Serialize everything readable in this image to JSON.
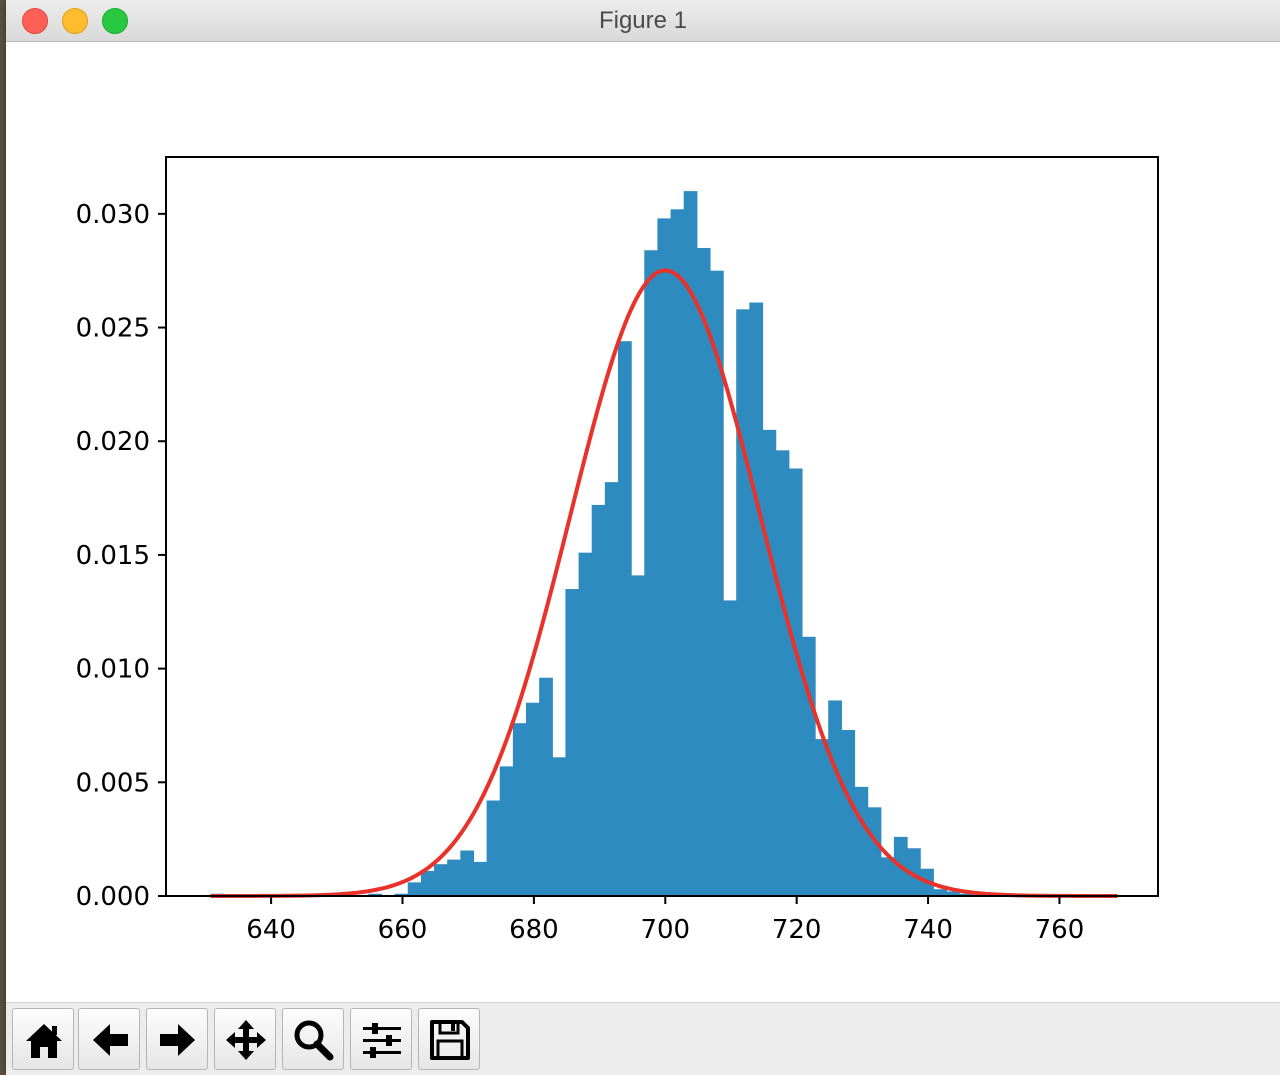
{
  "window": {
    "title": "Figure 1"
  },
  "toolbar": {
    "buttons": [
      {
        "name": "home-button",
        "icon": "home-icon"
      },
      {
        "name": "back-button",
        "icon": "arrow-left-icon"
      },
      {
        "name": "forward-button",
        "icon": "arrow-right-icon"
      },
      {
        "name": "pan-button",
        "icon": "move-icon"
      },
      {
        "name": "zoom-button",
        "icon": "zoom-icon"
      },
      {
        "name": "configure-subplots-button",
        "icon": "sliders-icon"
      },
      {
        "name": "save-button",
        "icon": "save-icon"
      }
    ]
  },
  "chart_data": {
    "type": "bar",
    "title": "",
    "xlabel": "",
    "ylabel": "",
    "xlim": [
      624,
      775
    ],
    "ylim": [
      0,
      0.0325
    ],
    "xticks": [
      "640",
      "660",
      "680",
      "700",
      "720",
      "740",
      "760"
    ],
    "xtick_values": [
      640,
      660,
      680,
      700,
      720,
      740,
      760
    ],
    "yticks": [
      "0.000",
      "0.005",
      "0.010",
      "0.015",
      "0.020",
      "0.025",
      "0.030"
    ],
    "ytick_values": [
      0,
      0.005,
      0.01,
      0.015,
      0.02,
      0.025,
      0.03
    ],
    "grid": false,
    "series": [
      {
        "kind": "histogram",
        "color": "#2e8bc0",
        "bin_edges": [
          630.8,
          632.8,
          634.8,
          636.8,
          638.8,
          640.8,
          642.8,
          644.8,
          646.8,
          648.8,
          650.8,
          652.8,
          654.8,
          656.8,
          658.8,
          660.8,
          662.8,
          664.8,
          666.8,
          668.8,
          670.8,
          672.8,
          674.8,
          676.8,
          678.8,
          680.8,
          682.8,
          684.8,
          686.8,
          688.8,
          690.8,
          692.8,
          694.8,
          696.8,
          698.8,
          700.8,
          702.8,
          704.8,
          706.8,
          708.8,
          710.8,
          712.8,
          714.8,
          716.8,
          718.8,
          720.8,
          722.8,
          724.8,
          726.8,
          728.8,
          730.8,
          732.8,
          734.8,
          736.8,
          738.8,
          740.8,
          742.8,
          744.8,
          746.8,
          748.8,
          750.8,
          752.8,
          754.8,
          756.8,
          758.8,
          760.8,
          762.8,
          764.8,
          766.8,
          768.8
        ],
        "density": [
          0.0001,
          0,
          0,
          0,
          0,
          0,
          0,
          0,
          0,
          0,
          0,
          0,
          0.0001,
          0,
          0.0001,
          0.0006,
          0.0011,
          0.0014,
          0.0016,
          0.002,
          0.0015,
          0.0042,
          0.0057,
          0.0076,
          0.0085,
          0.0096,
          0.0061,
          0.0135,
          0.0151,
          0.0172,
          0.0182,
          0.0244,
          0.0141,
          0.0284,
          0.0298,
          0.0302,
          0.031,
          0.0285,
          0.0275,
          0.013,
          0.0258,
          0.0261,
          0.0205,
          0.0196,
          0.0188,
          0.0114,
          0.0069,
          0.0086,
          0.0073,
          0.0048,
          0.0039,
          0.0017,
          0.0026,
          0.0021,
          0.0012,
          0.0003,
          0.0002,
          0.0001,
          0,
          0,
          0,
          0,
          0,
          0,
          0,
          0,
          0,
          0,
          0
        ]
      },
      {
        "kind": "pdf-line",
        "color": "#e8322a",
        "mean": 700,
        "std": 14.5,
        "x_range": [
          630.8,
          768.8
        ]
      }
    ]
  }
}
